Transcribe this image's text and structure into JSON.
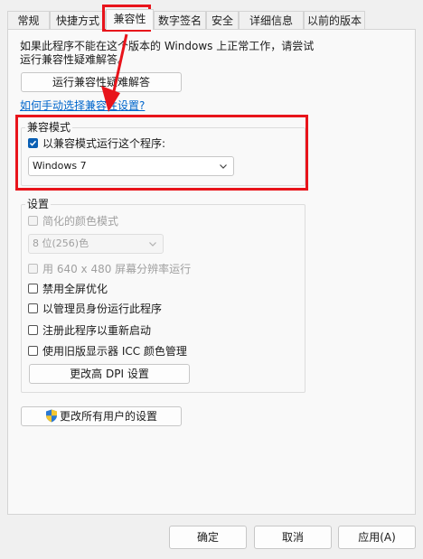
{
  "tabs": [
    "常规",
    "快捷方式",
    "兼容性",
    "数字签名",
    "安全",
    "详细信息",
    "以前的版本"
  ],
  "intro": {
    "line1": "如果此程序不能在这个版本的 Windows 上正常工作，请尝试",
    "line2": "运行兼容性疑难解答。"
  },
  "troubleshoot_button": "运行兼容性疑难解答",
  "manual_link": "如何手动选择兼容性设置?",
  "compat_mode": {
    "title": "兼容模式",
    "checkbox_label": "以兼容模式运行这个程序:",
    "checked": true,
    "selected_os": "Windows 7"
  },
  "settings": {
    "title": "设置",
    "reduced_color": "简化的颜色模式",
    "color_select": "8 位(256)色",
    "resolution": "用 640 x 480 屏幕分辨率运行",
    "fullscreen_opt": "禁用全屏优化",
    "run_as_admin": "以管理员身份运行此程序",
    "register_restart": "注册此程序以重新启动",
    "legacy_icc": "使用旧版显示器 ICC 颜色管理",
    "dpi_button": "更改高 DPI 设置"
  },
  "all_users_button": "更改所有用户的设置",
  "footer": {
    "ok": "确定",
    "cancel": "取消",
    "apply": "应用(A)"
  },
  "colors": {
    "highlight": "#e8141b",
    "accent": "#0a5fb4",
    "link": "#0066cc"
  }
}
